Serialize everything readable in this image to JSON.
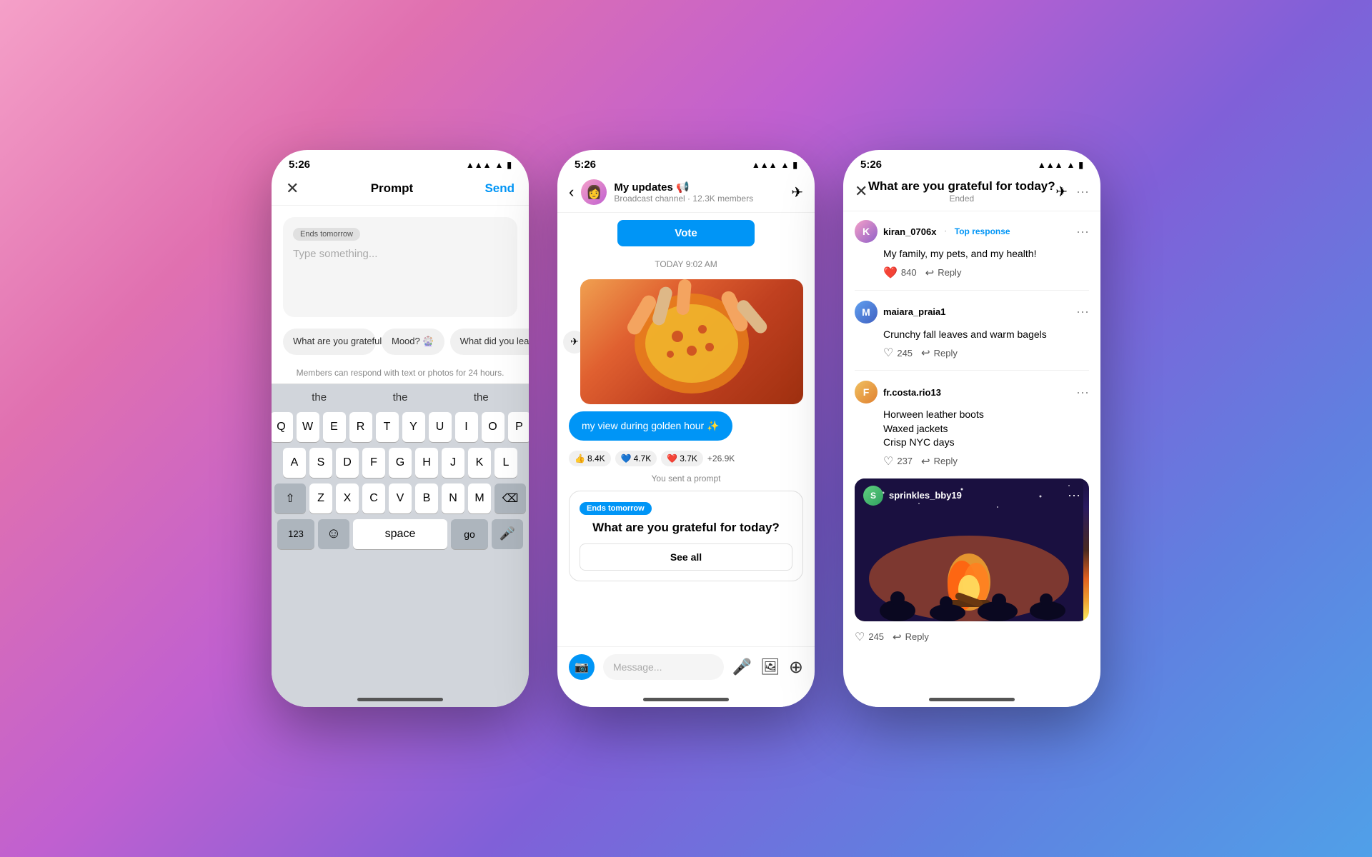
{
  "background": "gradient-pink-purple-blue",
  "phones": [
    {
      "id": "phone1",
      "type": "prompt-creator",
      "statusBar": {
        "time": "5:26",
        "signal": "▲▲▲",
        "wifi": "wifi",
        "battery": "🔋"
      },
      "header": {
        "close": "✕",
        "title": "Prompt",
        "send": "Send"
      },
      "inputArea": {
        "badge": "Ends tomorrow",
        "placeholder": "Type something..."
      },
      "chips": [
        "What are you grateful for today?",
        "Mood? 🎡",
        "What did you learn this week"
      ],
      "membersNote": "Members can respond with text or photos for 24 hours.",
      "keyboardSuggestions": [
        "the",
        "the",
        "the"
      ],
      "keyboardRows": [
        [
          "Q",
          "W",
          "E",
          "R",
          "T",
          "Y",
          "U",
          "I",
          "O",
          "P"
        ],
        [
          "A",
          "S",
          "D",
          "F",
          "G",
          "H",
          "J",
          "K",
          "L"
        ],
        [
          "⇧",
          "Z",
          "X",
          "C",
          "V",
          "B",
          "N",
          "M",
          "⌫"
        ],
        [
          "123",
          "space",
          "go"
        ]
      ]
    },
    {
      "id": "phone2",
      "type": "channel-chat",
      "statusBar": {
        "time": "5:26"
      },
      "header": {
        "back": "‹",
        "channelName": "My updates 📢",
        "channelSub": "Broadcast channel · 12.3K members",
        "sendIcon": "✈",
        "moreIcon": "···"
      },
      "chat": {
        "voteButton": "Vote",
        "timeLabel": "TODAY 9:02 AM",
        "messageBubble": "my view during golden hour ✨",
        "reactions": [
          {
            "emoji": "👍",
            "count": "8.4K"
          },
          {
            "emoji": "💙",
            "count": "4.7K"
          },
          {
            "emoji": "❤️",
            "count": "3.7K"
          },
          {
            "extra": "+26.9K"
          }
        ],
        "youSentLabel": "You sent a prompt",
        "promptCard": {
          "badge": "Ends tomorrow",
          "question": "What are you grateful for today?",
          "seeAll": "See all"
        }
      },
      "inputBar": {
        "placeholder": "Message...",
        "cameraIcon": "📷",
        "micIcon": "🎤",
        "galleryIcon": "🖼",
        "addIcon": "+"
      }
    },
    {
      "id": "phone3",
      "type": "responses",
      "statusBar": {
        "time": "5:26"
      },
      "header": {
        "close": "✕",
        "title": "What are you grateful for today?",
        "ended": "Ended",
        "sendIcon": "✈",
        "moreIcon": "···"
      },
      "responses": [
        {
          "username": "kiran_0706x",
          "badge": "Top response",
          "text": "My family, my pets, and my health!",
          "likes": "840",
          "likeType": "heart-filled",
          "hasReply": true,
          "replyLabel": "Reply"
        },
        {
          "username": "maiara_praia1",
          "text": "Crunchy fall leaves and warm bagels",
          "likes": "245",
          "likeType": "heart-outline",
          "hasReply": true,
          "replyLabel": "Reply"
        },
        {
          "username": "fr.costa.rio13",
          "text": "Horween leather boots\nWaxed jackets\nCrisp NYC days",
          "likes": "237",
          "likeType": "heart-outline",
          "hasReply": true,
          "replyLabel": "Reply"
        },
        {
          "username": "sprinkles_bby19",
          "isPhoto": true,
          "photoType": "campfire",
          "likes": "245",
          "likeType": "heart-outline",
          "hasReply": true,
          "replyLabel": "Reply"
        }
      ]
    }
  ]
}
